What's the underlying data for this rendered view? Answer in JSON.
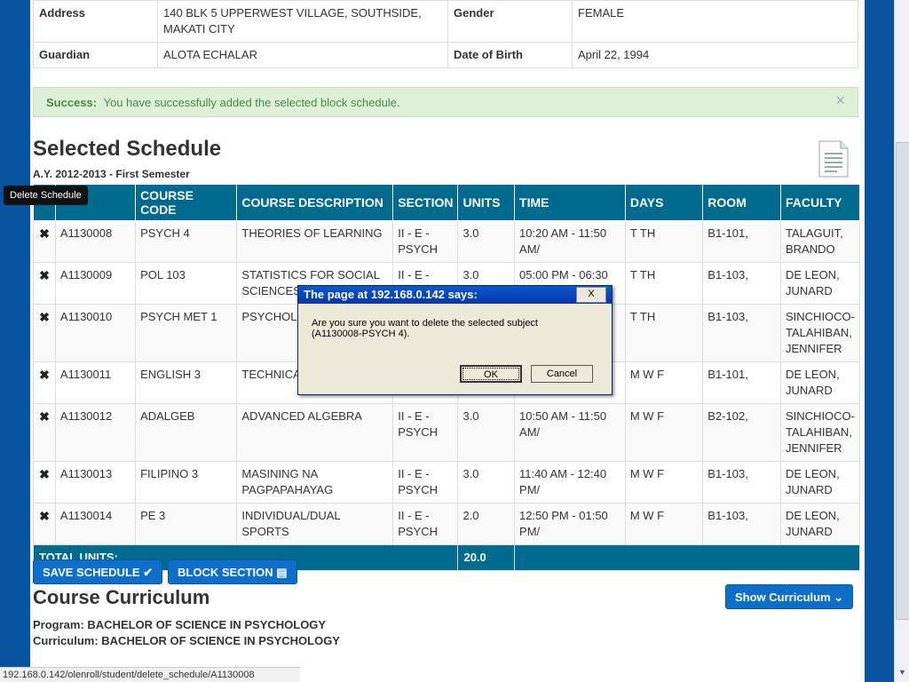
{
  "student_info": {
    "address_label": "Address",
    "address_line1": "140 BLK 5 UPPERWEST VILLAGE, SOUTHSIDE,",
    "address_line2": "MAKATI CITY",
    "gender_label": "Gender",
    "gender": "FEMALE",
    "guardian_label": "Guardian",
    "guardian": "ALOTA ECHALAR",
    "dob_label": "Date of Birth",
    "dob": "April 22, 1994"
  },
  "alert": {
    "strong": "Success:",
    "message": "You have successfully added the selected block schedule.",
    "close": "×"
  },
  "schedule": {
    "title": "Selected Schedule",
    "academic_year": "A.Y. 2012-2013 - First Semester",
    "tooltip": "Delete Schedule",
    "headers": {
      "course_code": "COURSE CODE",
      "description": "COURSE DESCRIPTION",
      "section": "SECTION",
      "units": "UNITS",
      "time": "TIME",
      "days": "DAYS",
      "room": "ROOM",
      "faculty": "FACULTY"
    },
    "rows": [
      {
        "del": "✖",
        "id": "A1130008",
        "code": "PSYCH 4",
        "desc": "THEORIES OF LEARNING",
        "section": "II - E - PSYCH",
        "units": "3.0",
        "time": "10:20 AM - 11:50 AM/",
        "days": "T TH",
        "room": "B1-101,",
        "faculty": "TALAGUIT, BRANDO"
      },
      {
        "del": "✖",
        "id": "A1130009",
        "code": "POL 103",
        "desc": "STATISTICS FOR SOCIAL SCIENCES",
        "section": "II - E - PSYCH",
        "units": "3.0",
        "time": "05:00 PM - 06:30 PM/",
        "days": "T TH",
        "room": "B1-103,",
        "faculty": "DE LEON, JUNARD"
      },
      {
        "del": "✖",
        "id": "A1130010",
        "code": "PSYCH MET 1",
        "desc": "PSYCHOL MEASURE",
        "section": "",
        "units": "",
        "time": "",
        "days": "T TH",
        "room": "B1-103,",
        "faculty": "SINCHIOCO-TALAHIBAN, JENNIFER"
      },
      {
        "del": "✖",
        "id": "A1130011",
        "code": "ENGLISH 3",
        "desc": "TECHNICA",
        "section": "",
        "units": "",
        "time": "",
        "days": "M W F",
        "room": "B1-101,",
        "faculty": "DE LEON, JUNARD"
      },
      {
        "del": "✖",
        "id": "A1130012",
        "code": "ADALGEB",
        "desc": "ADVANCED ALGEBRA",
        "section": "II - E - PSYCH",
        "units": "3.0",
        "time": "10:50 AM - 11:50 AM/",
        "days": "M W F",
        "room": "B2-102,",
        "faculty": "SINCHIOCO-TALAHIBAN, JENNIFER"
      },
      {
        "del": "✖",
        "id": "A1130013",
        "code": "FILIPINO 3",
        "desc": "MASINING NA PAGPAPAHAYAG",
        "section": "II - E - PSYCH",
        "units": "3.0",
        "time": "11:40 AM - 12:40 PM/",
        "days": "M W F",
        "room": "B1-103,",
        "faculty": "DE LEON, JUNARD"
      },
      {
        "del": "✖",
        "id": "A1130014",
        "code": "PE 3",
        "desc": "INDIVIDUAL/DUAL SPORTS",
        "section": "II - E - PSYCH",
        "units": "2.0",
        "time": "12:50 PM - 01:50 PM/",
        "days": "M W F",
        "room": "B1-103,",
        "faculty": "DE LEON, JUNARD"
      }
    ],
    "total_label": "TOTAL UNITS:",
    "total_units": "20.0"
  },
  "buttons": {
    "save": "SAVE SCHEDULE",
    "block": "BLOCK SECTION",
    "show_curriculum": "Show Curriculum"
  },
  "curriculum": {
    "title": "Course Curriculum",
    "program": "Program: BACHELOR OF SCIENCE IN PSYCHOLOGY",
    "curriculum": "Curriculum: BACHELOR OF SCIENCE IN PSYCHOLOGY"
  },
  "statusbar": {
    "url": "192.168.0.142/olenroll/student/delete_schedule/A1130008"
  },
  "dialog": {
    "title": "The page at 192.168.0.142 says:",
    "close": "X",
    "message_line1": "Are you sure you want to delete the selected subject",
    "message_line2": "(A1130008-PSYCH 4).",
    "ok": "OK",
    "cancel": "Cancel"
  },
  "colors": {
    "header_bg": "#006b8f",
    "button_bg": "#0d6fc9",
    "alert_bg": "#dff0d8",
    "page_bg": "#0753a0"
  }
}
